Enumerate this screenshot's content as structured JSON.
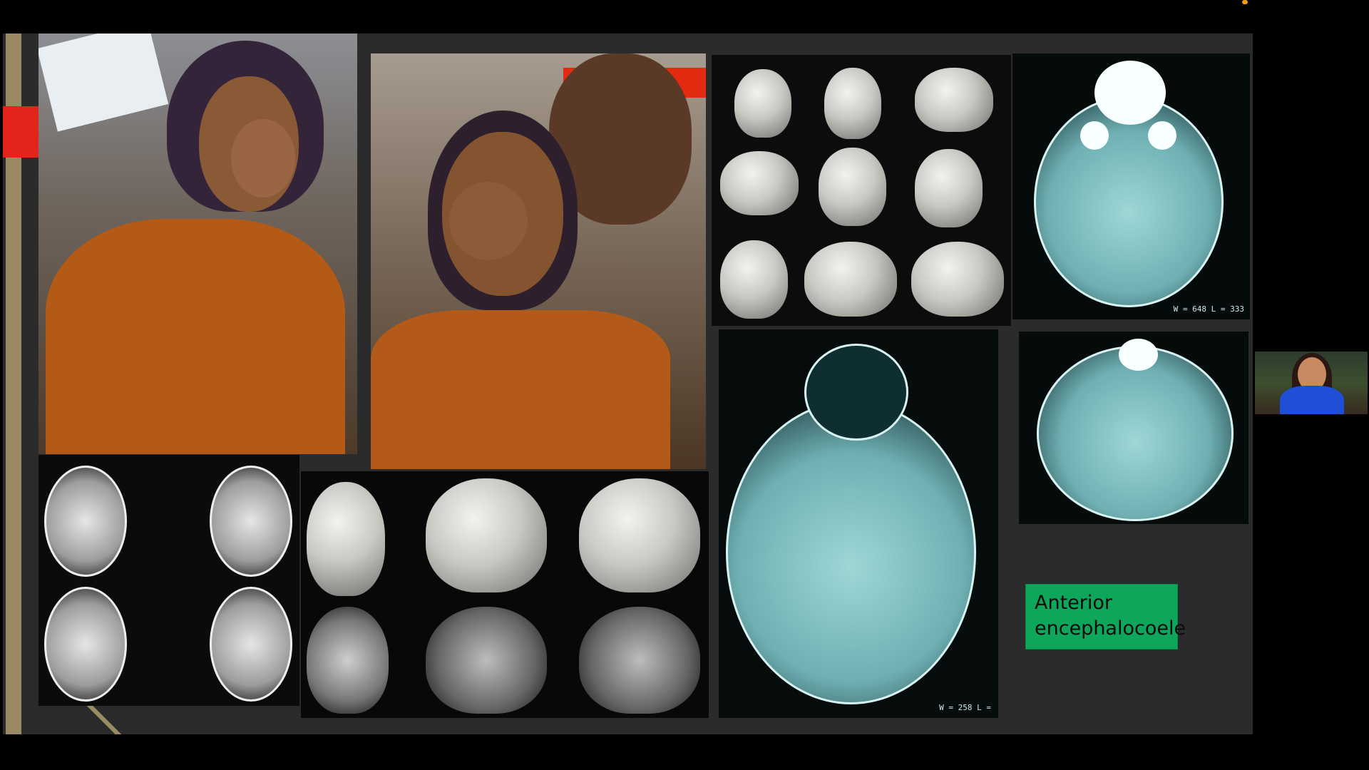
{
  "slide": {
    "caption_line1": "Anterior",
    "caption_line2": "encephalocoele",
    "mri_top_right_meta": "W = 648 L = 333",
    "mri_bottom_meta": "W = 258 L =",
    "colors": {
      "slide_bg": "#2b2b2b",
      "caption_bg": "#0ea65a",
      "accent_red": "#e2251b",
      "accent_gold": "#9a8a64"
    }
  },
  "webcam": {
    "icon": "presenter-video-icon"
  }
}
